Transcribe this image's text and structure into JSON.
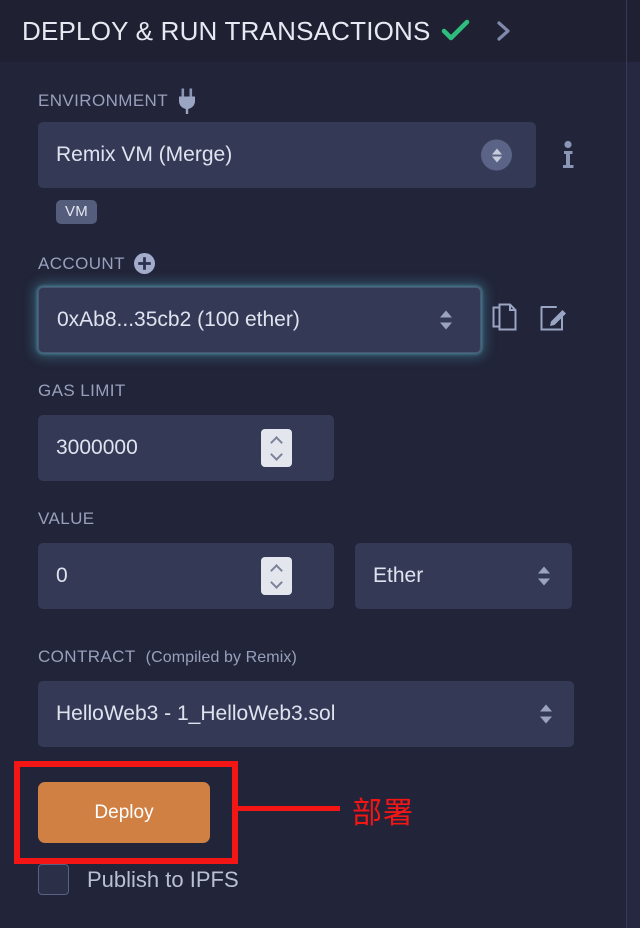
{
  "header": {
    "title": "DEPLOY & RUN TRANSACTIONS",
    "status_icon": "check-icon",
    "expand_icon": "chevron-right-icon",
    "check_color": "#2fbd7e",
    "chevron_color": "#7f89ad"
  },
  "environment": {
    "label": "ENVIRONMENT",
    "icon": "plug-icon",
    "value": "Remix VM (Merge)",
    "info_icon": "info-icon",
    "badge": "VM"
  },
  "account": {
    "label": "ACCOUNT",
    "add_icon": "plus-circle-icon",
    "value": "0xAb8...35cb2 (100 ether)",
    "copy_icon": "copy-icon",
    "edit_icon": "edit-icon",
    "focus_color": "#56bed2"
  },
  "gas_limit": {
    "label": "GAS LIMIT",
    "value": "3000000"
  },
  "value_field": {
    "label": "VALUE",
    "value": "0",
    "unit": "Ether"
  },
  "contract": {
    "label": "CONTRACT",
    "sub_label": "(Compiled by Remix)",
    "value": "HelloWeb3 - 1_HelloWeb3.sol"
  },
  "deploy": {
    "label": "Deploy",
    "color": "#d08042"
  },
  "ipfs": {
    "label": "Publish to IPFS",
    "checked": false
  },
  "annotation": {
    "text": "部署",
    "color": "#f41515"
  }
}
